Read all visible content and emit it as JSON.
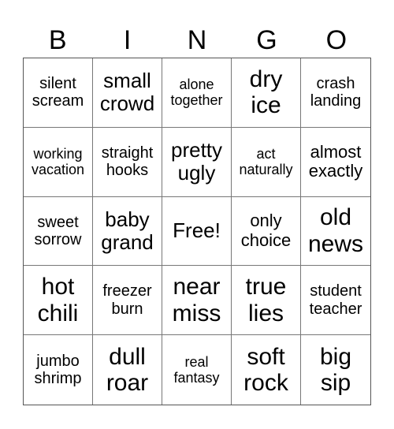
{
  "header": [
    "B",
    "I",
    "N",
    "G",
    "O"
  ],
  "cells": [
    {
      "text": "silent scream",
      "size": "s2"
    },
    {
      "text": "small crowd",
      "size": "s4"
    },
    {
      "text": "alone together",
      "size": "s1"
    },
    {
      "text": "dry ice",
      "size": "s5"
    },
    {
      "text": "crash landing",
      "size": "s2"
    },
    {
      "text": "working vacation",
      "size": "s1"
    },
    {
      "text": "straight hooks",
      "size": "s2"
    },
    {
      "text": "pretty ugly",
      "size": "s4"
    },
    {
      "text": "act naturally",
      "size": "s1"
    },
    {
      "text": "almost exactly",
      "size": "s3"
    },
    {
      "text": "sweet sorrow",
      "size": "s2"
    },
    {
      "text": "baby grand",
      "size": "s4"
    },
    {
      "text": "Free!",
      "size": "s4"
    },
    {
      "text": "only choice",
      "size": "s3"
    },
    {
      "text": "old news",
      "size": "s5"
    },
    {
      "text": "hot chili",
      "size": "s5"
    },
    {
      "text": "freezer burn",
      "size": "s2"
    },
    {
      "text": "near miss",
      "size": "s5"
    },
    {
      "text": "true lies",
      "size": "s5"
    },
    {
      "text": "student teacher",
      "size": "s2"
    },
    {
      "text": "jumbo shrimp",
      "size": "s2"
    },
    {
      "text": "dull roar",
      "size": "s5"
    },
    {
      "text": "real fantasy",
      "size": "s1"
    },
    {
      "text": "soft rock",
      "size": "s5"
    },
    {
      "text": "big sip",
      "size": "s5"
    }
  ]
}
